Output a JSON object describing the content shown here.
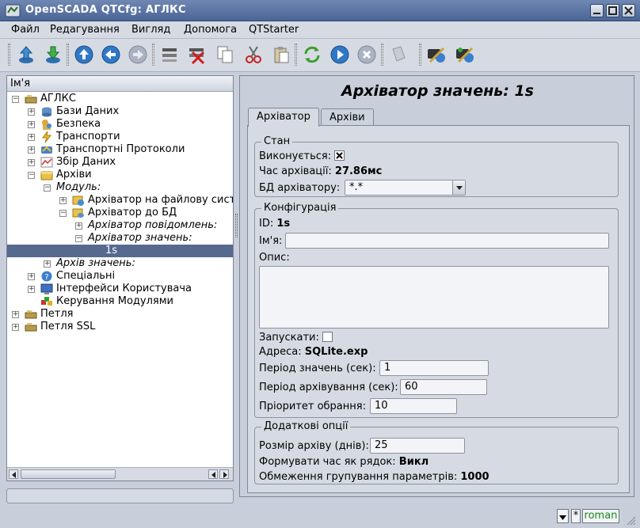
{
  "window": {
    "title": "OpenSCADA QTCfg: АГЛКС"
  },
  "menu": [
    "Файл",
    "Редагування",
    "Вигляд",
    "Допомога",
    "QTStarter"
  ],
  "tree": {
    "header": "Ім'я",
    "rows": [
      {
        "label": "АГЛКС"
      },
      {
        "label": "Бази Даних"
      },
      {
        "label": "Безпека"
      },
      {
        "label": "Транспорти"
      },
      {
        "label": "Транспортні Протоколи"
      },
      {
        "label": "Збір Даних"
      },
      {
        "label": "Архіви"
      },
      {
        "label": "Модуль:"
      },
      {
        "label": "Архіватор на файлову сист"
      },
      {
        "label": "Архіватор до БД"
      },
      {
        "label": "Архіватор повідомлень:"
      },
      {
        "label": "Архіватор значень:"
      },
      {
        "label": "1s"
      },
      {
        "label": "Архів значень:"
      },
      {
        "label": "Спеціальні"
      },
      {
        "label": "Інтерфейси Користувача"
      },
      {
        "label": "Керування Модулями"
      },
      {
        "label": "Петля"
      },
      {
        "label": "Петля SSL"
      }
    ]
  },
  "page": {
    "title": "Архіватор значень: 1s",
    "tabs": [
      "Архіватор",
      "Архіви"
    ],
    "state": {
      "title": "Стан",
      "running_label": "Виконується:",
      "running": true,
      "time_label": "Час архівації:",
      "time_value": "27.86мс",
      "db_label": "БД архіватору:",
      "db_value": "*.*"
    },
    "config": {
      "title": "Конфігурація",
      "id_label": "ID:",
      "id_value": "1s",
      "name_label": "Ім'я:",
      "name_value": "",
      "descr_label": "Опис:",
      "descr_value": "",
      "start_label": "Запускати:",
      "start": false,
      "addr_label": "Адреса:",
      "addr_value": "SQLite.exp",
      "vper_label": "Період значень (сек):",
      "vper_value": "1",
      "aper_label": "Період архівування (сек):",
      "aper_value": "60",
      "prior_label": "Пріоритет обрання:",
      "prior_value": "10"
    },
    "extra": {
      "title": "Додаткові опції",
      "size_label": "Розмір архіву (днів):",
      "size_value": "25",
      "tmstr_label": "Формувати час як рядок:",
      "tmstr_value": "Викл",
      "grp_label": "Обмеження групування параметрів:",
      "grp_value": "1000"
    }
  },
  "status": {
    "star": "*",
    "user": "roman"
  },
  "colors": {
    "selection": "#56698f",
    "titlebar": "#4a6596",
    "user_text": "#1a8a1a"
  }
}
